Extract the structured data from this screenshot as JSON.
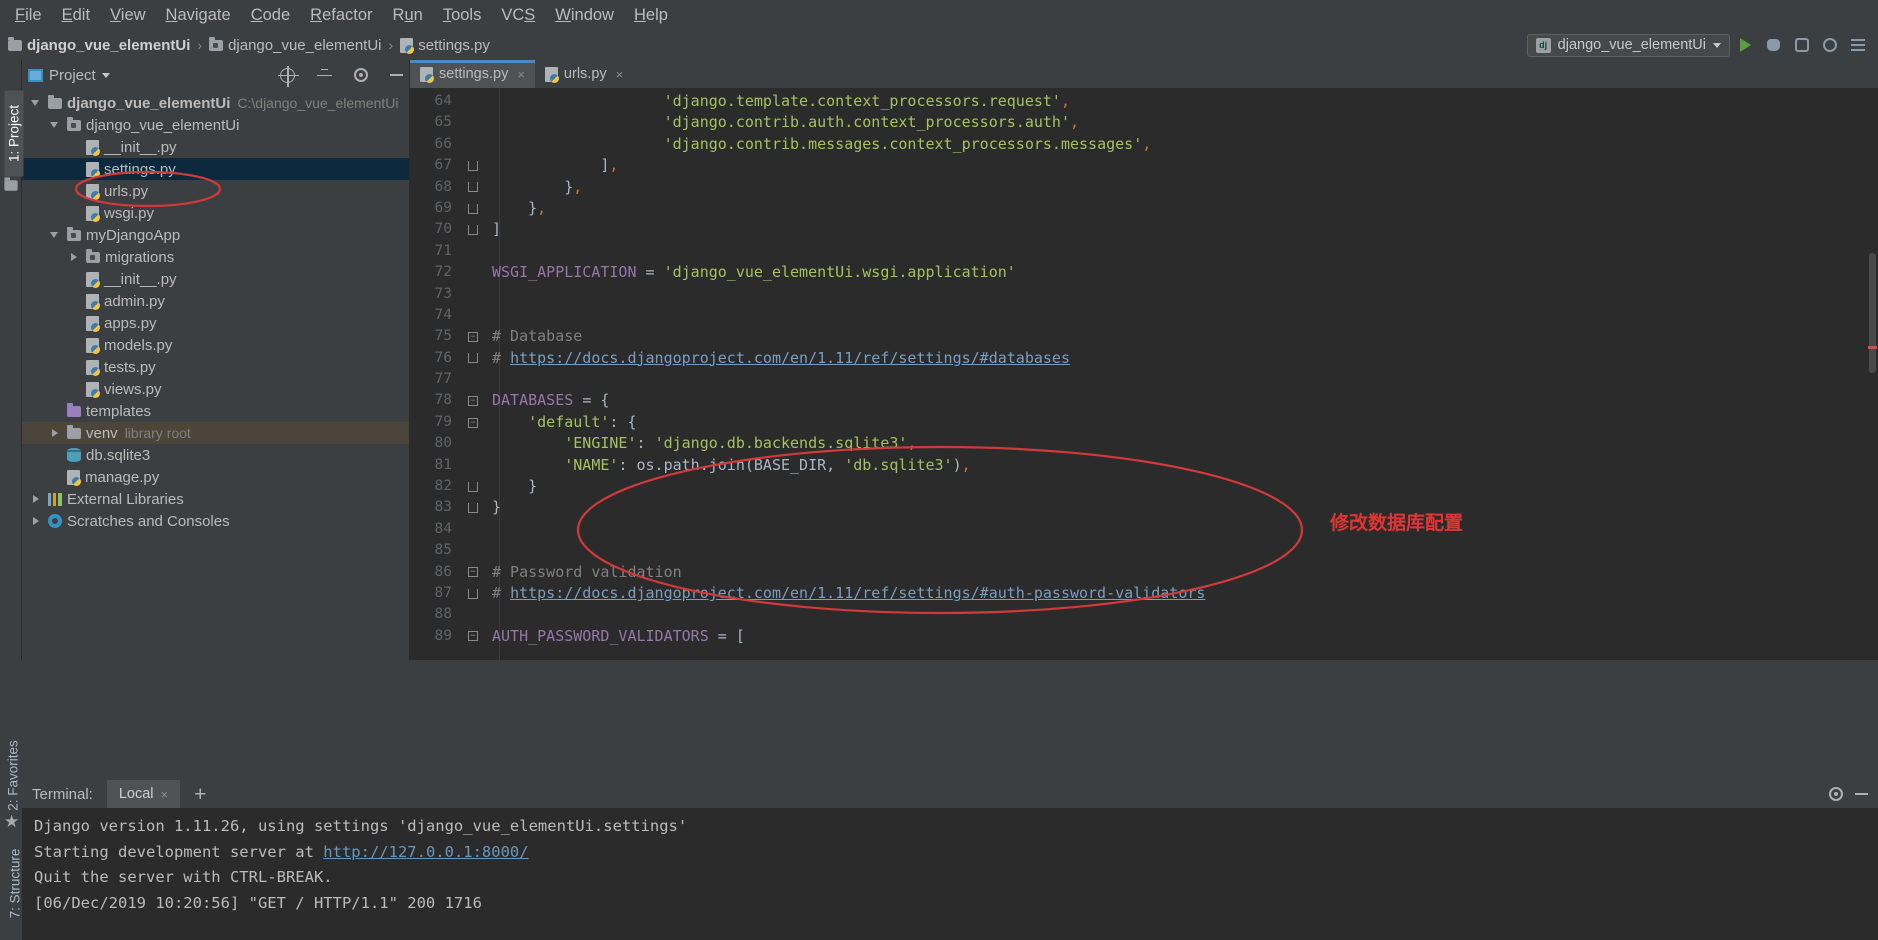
{
  "menu": {
    "items": [
      {
        "label": "File",
        "mnemonic": "F"
      },
      {
        "label": "Edit",
        "mnemonic": "E"
      },
      {
        "label": "View",
        "mnemonic": "V"
      },
      {
        "label": "Navigate",
        "mnemonic": "N"
      },
      {
        "label": "Code",
        "mnemonic": "C"
      },
      {
        "label": "Refactor",
        "mnemonic": "R"
      },
      {
        "label": "Run",
        "mnemonic": "u"
      },
      {
        "label": "Tools",
        "mnemonic": "T"
      },
      {
        "label": "VCS",
        "mnemonic": "S"
      },
      {
        "label": "Window",
        "mnemonic": "W"
      },
      {
        "label": "Help",
        "mnemonic": "H"
      }
    ]
  },
  "breadcrumb": {
    "items": [
      "django_vue_elementUi",
      "django_vue_elementUi",
      "settings.py"
    ],
    "separator": "›"
  },
  "run_config": {
    "name": "django_vue_elementUi",
    "badge": "dj"
  },
  "toolbar": {
    "run_title": "Run",
    "debug_title": "Debug",
    "coverage_title": "Run with Coverage",
    "profile_title": "Profile",
    "todo_title": "Show Tool Windows"
  },
  "left_strip": {
    "project_tab": "1: Project",
    "favorites_tab": "2: Favorites",
    "structure_tab": "7: Structure"
  },
  "project_panel": {
    "title": "Project",
    "tree": [
      {
        "depth": 0,
        "label": "django_vue_elementUi",
        "sub": "C:\\django_vue_elementUi",
        "icon": "folder-root",
        "twisty": "down",
        "bold": true
      },
      {
        "depth": 1,
        "label": "django_vue_elementUi",
        "sub": "",
        "icon": "folder-module",
        "twisty": "down",
        "bold": false
      },
      {
        "depth": 2,
        "label": "__init__.py",
        "sub": "",
        "icon": "python-file",
        "twisty": "none",
        "bold": false
      },
      {
        "depth": 2,
        "label": "settings.py",
        "sub": "",
        "icon": "python-file",
        "twisty": "none",
        "bold": false,
        "selected": true,
        "circled": true
      },
      {
        "depth": 2,
        "label": "urls.py",
        "sub": "",
        "icon": "python-file",
        "twisty": "none",
        "bold": false
      },
      {
        "depth": 2,
        "label": "wsgi.py",
        "sub": "",
        "icon": "python-file",
        "twisty": "none",
        "bold": false
      },
      {
        "depth": 1,
        "label": "myDjangoApp",
        "sub": "",
        "icon": "folder-module",
        "twisty": "down",
        "bold": false
      },
      {
        "depth": 2,
        "label": "migrations",
        "sub": "",
        "icon": "folder-module",
        "twisty": "right",
        "bold": false
      },
      {
        "depth": 2,
        "label": "__init__.py",
        "sub": "",
        "icon": "python-file",
        "twisty": "none",
        "bold": false
      },
      {
        "depth": 2,
        "label": "admin.py",
        "sub": "",
        "icon": "python-file",
        "twisty": "none",
        "bold": false
      },
      {
        "depth": 2,
        "label": "apps.py",
        "sub": "",
        "icon": "python-file",
        "twisty": "none",
        "bold": false
      },
      {
        "depth": 2,
        "label": "models.py",
        "sub": "",
        "icon": "python-file",
        "twisty": "none",
        "bold": false
      },
      {
        "depth": 2,
        "label": "tests.py",
        "sub": "",
        "icon": "python-file",
        "twisty": "none",
        "bold": false
      },
      {
        "depth": 2,
        "label": "views.py",
        "sub": "",
        "icon": "python-file",
        "twisty": "none",
        "bold": false
      },
      {
        "depth": 1,
        "label": "templates",
        "sub": "",
        "icon": "folder-templates",
        "twisty": "none",
        "bold": false
      },
      {
        "depth": 1,
        "label": "venv",
        "sub": "library root",
        "icon": "folder-plain",
        "twisty": "right",
        "bold": false,
        "highlight": true
      },
      {
        "depth": 1,
        "label": "db.sqlite3",
        "sub": "",
        "icon": "database-file",
        "twisty": "none",
        "bold": false
      },
      {
        "depth": 1,
        "label": "manage.py",
        "sub": "",
        "icon": "python-file",
        "twisty": "none",
        "bold": false
      },
      {
        "depth": 0,
        "label": "External Libraries",
        "sub": "",
        "icon": "libraries",
        "twisty": "right",
        "bold": false
      },
      {
        "depth": 0,
        "label": "Scratches and Consoles",
        "sub": "",
        "icon": "scratches",
        "twisty": "right",
        "bold": false
      }
    ]
  },
  "editor": {
    "tabs": [
      {
        "label": "settings.py",
        "active": true,
        "close": "×"
      },
      {
        "label": "urls.py",
        "active": false,
        "close": "×"
      }
    ],
    "first_line": 64,
    "lines": [
      {
        "n": 64,
        "fold": "",
        "tokens": [
          {
            "t": "                   ",
            "c": "def"
          },
          {
            "t": "'django.template.context_processors.request'",
            "c": "str"
          },
          {
            "t": ",",
            "c": "pun"
          }
        ]
      },
      {
        "n": 65,
        "fold": "",
        "tokens": [
          {
            "t": "                   ",
            "c": "def"
          },
          {
            "t": "'django.contrib.auth.context_processors.auth'",
            "c": "str"
          },
          {
            "t": ",",
            "c": "pun"
          }
        ]
      },
      {
        "n": 66,
        "fold": "",
        "tokens": [
          {
            "t": "                   ",
            "c": "def"
          },
          {
            "t": "'django.contrib.messages.context_processors.messages'",
            "c": "str"
          },
          {
            "t": ",",
            "c": "pun"
          }
        ]
      },
      {
        "n": 67,
        "fold": "end",
        "tokens": [
          {
            "t": "            ]",
            "c": "def"
          },
          {
            "t": ",",
            "c": "pun"
          }
        ]
      },
      {
        "n": 68,
        "fold": "end",
        "tokens": [
          {
            "t": "        }",
            "c": "def"
          },
          {
            "t": ",",
            "c": "pun"
          }
        ]
      },
      {
        "n": 69,
        "fold": "end",
        "tokens": [
          {
            "t": "    }",
            "c": "def"
          },
          {
            "t": ",",
            "c": "pun"
          }
        ]
      },
      {
        "n": 70,
        "fold": "end",
        "tokens": [
          {
            "t": "]",
            "c": "def"
          }
        ]
      },
      {
        "n": 71,
        "fold": "",
        "tokens": []
      },
      {
        "n": 72,
        "fold": "",
        "tokens": [
          {
            "t": "WSGI_APPLICATION ",
            "c": "glb"
          },
          {
            "t": "= ",
            "c": "def"
          },
          {
            "t": "'django_vue_elementUi.wsgi.application'",
            "c": "str"
          }
        ]
      },
      {
        "n": 73,
        "fold": "",
        "tokens": []
      },
      {
        "n": 74,
        "fold": "",
        "tokens": []
      },
      {
        "n": 75,
        "fold": "start",
        "tokens": [
          {
            "t": "# Database",
            "c": "com"
          }
        ]
      },
      {
        "n": 76,
        "fold": "end",
        "tokens": [
          {
            "t": "# ",
            "c": "com"
          },
          {
            "t": "https://docs.djangoproject.com/en/1.11/ref/settings/#databases",
            "c": "lnk"
          }
        ]
      },
      {
        "n": 77,
        "fold": "",
        "tokens": []
      },
      {
        "n": 78,
        "fold": "start",
        "tokens": [
          {
            "t": "DATABASES ",
            "c": "glb"
          },
          {
            "t": "= {",
            "c": "def"
          }
        ]
      },
      {
        "n": 79,
        "fold": "start",
        "tokens": [
          {
            "t": "    ",
            "c": "def"
          },
          {
            "t": "'default'",
            "c": "str"
          },
          {
            "t": ": {",
            "c": "def"
          }
        ]
      },
      {
        "n": 80,
        "fold": "",
        "tokens": [
          {
            "t": "        ",
            "c": "def"
          },
          {
            "t": "'ENGINE'",
            "c": "str"
          },
          {
            "t": ": ",
            "c": "def"
          },
          {
            "t": "'django.db.backends.sqlite3'",
            "c": "str"
          },
          {
            "t": ",",
            "c": "pun"
          }
        ]
      },
      {
        "n": 81,
        "fold": "",
        "tokens": [
          {
            "t": "        ",
            "c": "def"
          },
          {
            "t": "'NAME'",
            "c": "str"
          },
          {
            "t": ": os.path.join(BASE_DIR, ",
            "c": "def"
          },
          {
            "t": "'db.sqlite3'",
            "c": "str"
          },
          {
            "t": ")",
            "c": "def"
          },
          {
            "t": ",",
            "c": "pun"
          }
        ]
      },
      {
        "n": 82,
        "fold": "end",
        "tokens": [
          {
            "t": "    }",
            "c": "def"
          }
        ]
      },
      {
        "n": 83,
        "fold": "end",
        "tokens": [
          {
            "t": "}",
            "c": "def"
          }
        ]
      },
      {
        "n": 84,
        "fold": "",
        "tokens": []
      },
      {
        "n": 85,
        "fold": "",
        "tokens": []
      },
      {
        "n": 86,
        "fold": "start",
        "tokens": [
          {
            "t": "# Password validation",
            "c": "com"
          }
        ]
      },
      {
        "n": 87,
        "fold": "end",
        "tokens": [
          {
            "t": "# ",
            "c": "com"
          },
          {
            "t": "https://docs.djangoproject.com/en/1.11/ref/settings/#auth-password-validators",
            "c": "lnk"
          }
        ]
      },
      {
        "n": 88,
        "fold": "",
        "tokens": []
      },
      {
        "n": 89,
        "fold": "start",
        "tokens": [
          {
            "t": "AUTH_PASSWORD_VALIDATORS ",
            "c": "glb"
          },
          {
            "t": "= [",
            "c": "def"
          }
        ]
      }
    ]
  },
  "annotations": {
    "database_note": "修改数据库配置",
    "color": "#e03535"
  },
  "terminal": {
    "label": "Terminal:",
    "tab": "Local",
    "tab_close": "×",
    "add": "+",
    "lines": [
      {
        "text": "Django version 1.11.26, using settings 'django_vue_elementUi.settings'",
        "link": ""
      },
      {
        "text": "Starting development server at ",
        "link": "http://127.0.0.1:8000/"
      },
      {
        "text": "Quit the server with CTRL-BREAK.",
        "link": ""
      },
      {
        "text": "[06/Dec/2019 10:20:56] \"GET / HTTP/1.1\" 200 1716",
        "link": ""
      }
    ]
  }
}
